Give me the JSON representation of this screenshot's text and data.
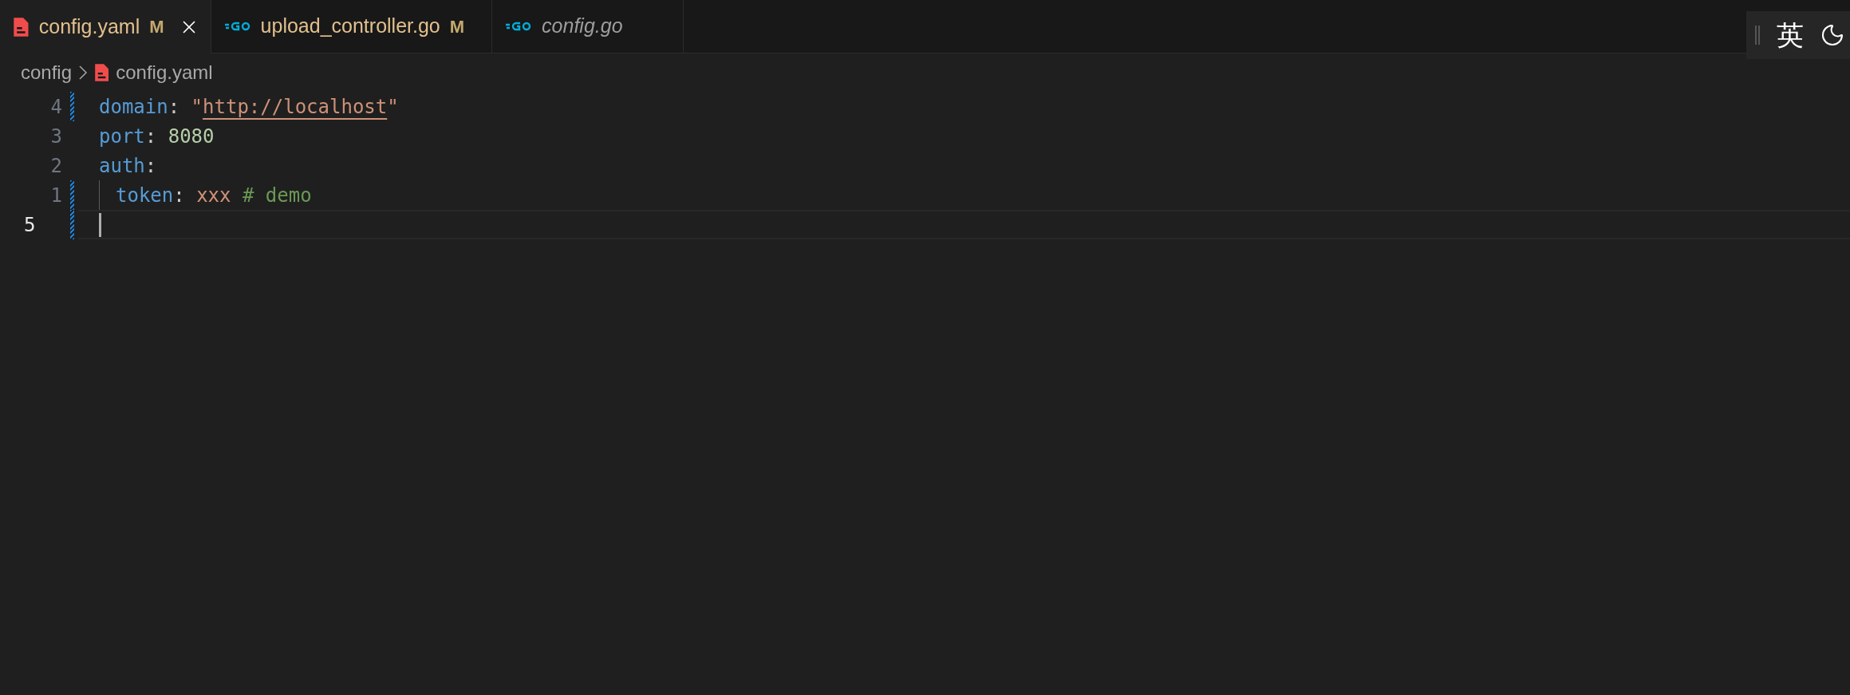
{
  "tabs": [
    {
      "label": "config.yaml",
      "kind": "yaml",
      "badge": "M",
      "italic": false,
      "selected": true
    },
    {
      "label": "upload_controller.go",
      "kind": "go",
      "badge": "M",
      "italic": false,
      "selected": false
    },
    {
      "label": "config.go",
      "kind": "go",
      "italic": true,
      "selected": false
    }
  ],
  "ime": {
    "mode": "英"
  },
  "breadcrumb": [
    {
      "label": "config",
      "kind": "folder"
    },
    {
      "label": "config.yaml",
      "kind": "yaml"
    }
  ],
  "lines": [
    {
      "number": "4",
      "current": false,
      "modified": true,
      "indented": false,
      "tokens": [
        {
          "kind": "key",
          "text": "domain"
        },
        {
          "kind": "punct",
          "text": ": "
        },
        {
          "kind": "string",
          "text": "\""
        },
        {
          "kind": "link",
          "text": "http://localhost"
        },
        {
          "kind": "string",
          "text": "\""
        }
      ]
    },
    {
      "number": "3",
      "current": false,
      "modified": false,
      "indented": false,
      "tokens": [
        {
          "kind": "key",
          "text": "port"
        },
        {
          "kind": "punct",
          "text": ": "
        },
        {
          "kind": "number",
          "text": "8080"
        }
      ]
    },
    {
      "number": "2",
      "current": false,
      "modified": false,
      "indented": false,
      "tokens": [
        {
          "kind": "key",
          "text": "auth"
        },
        {
          "kind": "punct",
          "text": ":"
        }
      ]
    },
    {
      "number": "1",
      "current": false,
      "modified": true,
      "indented": true,
      "tokens": [
        {
          "kind": "key",
          "text": "token"
        },
        {
          "kind": "punct",
          "text": ": "
        },
        {
          "kind": "string",
          "text": "xxx"
        },
        {
          "kind": "comment",
          "text": " # demo"
        }
      ]
    },
    {
      "number": "5",
      "current": true,
      "modified": true,
      "indented": false
    }
  ]
}
